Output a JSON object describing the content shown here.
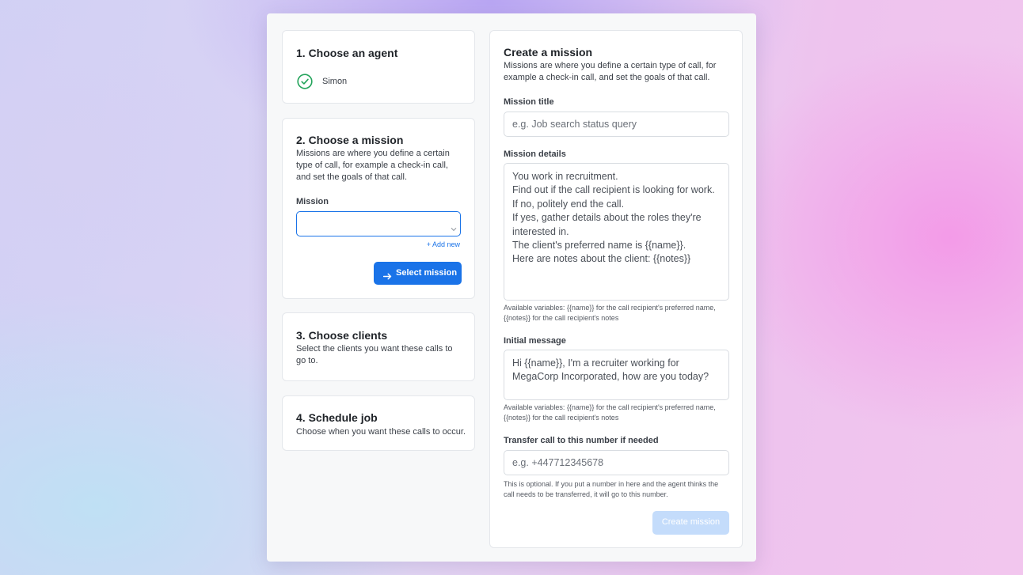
{
  "agent_card": {
    "title": "1. Choose an agent",
    "agent_name": "Simon",
    "check_icon": "check-circle-icon",
    "check_color": "#22a35a"
  },
  "mission_card": {
    "title": "2. Choose a mission",
    "description": "Missions are where you define a certain type of call, for example a check-in call, and set the goals of that call.",
    "field_label": "Mission",
    "selected_value": "",
    "add_new_label": "+ Add new",
    "select_button_label": "Select mission",
    "select_button_icon": "arrow-right-icon",
    "accent_color": "#1a73e8"
  },
  "clients_card": {
    "title": "3. Choose clients",
    "description": "Select the clients you want these calls to go to."
  },
  "schedule_card": {
    "title": "4. Schedule job",
    "description": "Choose when you want these calls to occur."
  },
  "create_mission": {
    "title": "Create a mission",
    "description": "Missions are where you define a certain type of call, for example a check-in call, and set the goals of that call.",
    "mission_title_label": "Mission title",
    "mission_title_placeholder": "e.g. Job search status query",
    "mission_details_label": "Mission details",
    "mission_details_value": "You work in recruitment.\nFind out if the call recipient is looking for work.\nIf no, politely end the call.\nIf yes, gather details about the roles they're interested in.\nThe client's preferred name is {{name}}.\nHere are notes about the client: {{notes}}",
    "mission_details_help": "Available variables: {{name}} for the call recipient's preferred name, {{notes}} for the call recipient's notes",
    "initial_message_label": "Initial message",
    "initial_message_value": "Hi {{name}}, I'm a recruiter working for MegaCorp Incorporated, how are you today?",
    "initial_message_help": "Available variables: {{name}} for the call recipient's preferred name, {{notes}} for the call recipient's notes",
    "transfer_label": "Transfer call to this number if needed",
    "transfer_placeholder": "e.g. +447712345678",
    "transfer_help": "This is optional. If you put a number in here and the agent thinks the call needs to be transferred, it will go to this number.",
    "submit_label": "Create mission",
    "submit_disabled_color": "#c4dcfb"
  }
}
